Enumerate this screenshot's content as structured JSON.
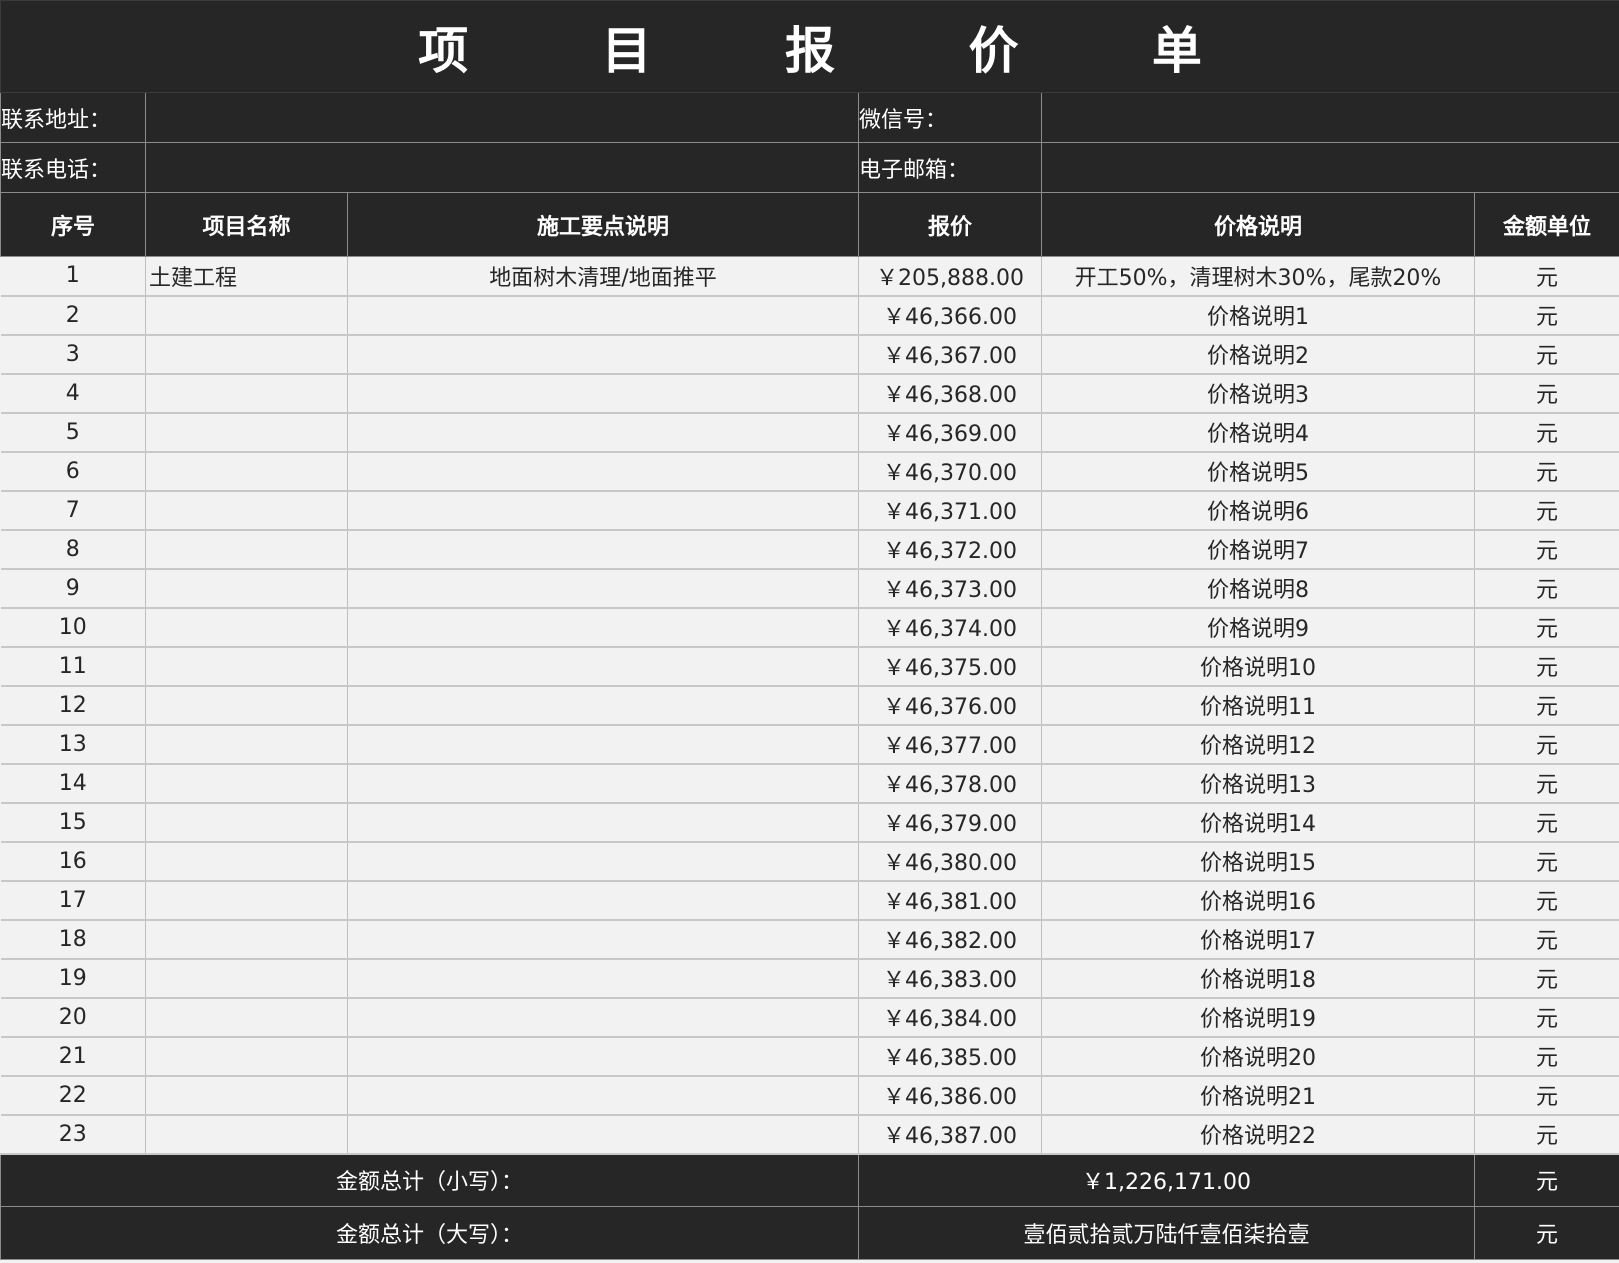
{
  "title": "项 目 报 价 单",
  "contact": {
    "address_label": "联系地址：",
    "address_value": "",
    "wechat_label": "微信号：",
    "wechat_value": "",
    "phone_label": "联系电话：",
    "phone_value": "",
    "email_label": "电子邮箱：",
    "email_value": ""
  },
  "columns": [
    "序号",
    "项目名称",
    "施工要点说明",
    "报价",
    "价格说明",
    "金额单位"
  ],
  "rows": [
    {
      "no": "1",
      "name": "土建工程",
      "points": "地面树木清理/地面推平",
      "price": "￥205,888.00",
      "note": "开工50%，清理树木30%，尾款20%",
      "unit": "元"
    },
    {
      "no": "2",
      "name": "",
      "points": "",
      "price": "￥46,366.00",
      "note": "价格说明1",
      "unit": "元"
    },
    {
      "no": "3",
      "name": "",
      "points": "",
      "price": "￥46,367.00",
      "note": "价格说明2",
      "unit": "元"
    },
    {
      "no": "4",
      "name": "",
      "points": "",
      "price": "￥46,368.00",
      "note": "价格说明3",
      "unit": "元"
    },
    {
      "no": "5",
      "name": "",
      "points": "",
      "price": "￥46,369.00",
      "note": "价格说明4",
      "unit": "元"
    },
    {
      "no": "6",
      "name": "",
      "points": "",
      "price": "￥46,370.00",
      "note": "价格说明5",
      "unit": "元"
    },
    {
      "no": "7",
      "name": "",
      "points": "",
      "price": "￥46,371.00",
      "note": "价格说明6",
      "unit": "元"
    },
    {
      "no": "8",
      "name": "",
      "points": "",
      "price": "￥46,372.00",
      "note": "价格说明7",
      "unit": "元"
    },
    {
      "no": "9",
      "name": "",
      "points": "",
      "price": "￥46,373.00",
      "note": "价格说明8",
      "unit": "元"
    },
    {
      "no": "10",
      "name": "",
      "points": "",
      "price": "￥46,374.00",
      "note": "价格说明9",
      "unit": "元"
    },
    {
      "no": "11",
      "name": "",
      "points": "",
      "price": "￥46,375.00",
      "note": "价格说明10",
      "unit": "元"
    },
    {
      "no": "12",
      "name": "",
      "points": "",
      "price": "￥46,376.00",
      "note": "价格说明11",
      "unit": "元"
    },
    {
      "no": "13",
      "name": "",
      "points": "",
      "price": "￥46,377.00",
      "note": "价格说明12",
      "unit": "元"
    },
    {
      "no": "14",
      "name": "",
      "points": "",
      "price": "￥46,378.00",
      "note": "价格说明13",
      "unit": "元"
    },
    {
      "no": "15",
      "name": "",
      "points": "",
      "price": "￥46,379.00",
      "note": "价格说明14",
      "unit": "元"
    },
    {
      "no": "16",
      "name": "",
      "points": "",
      "price": "￥46,380.00",
      "note": "价格说明15",
      "unit": "元"
    },
    {
      "no": "17",
      "name": "",
      "points": "",
      "price": "￥46,381.00",
      "note": "价格说明16",
      "unit": "元"
    },
    {
      "no": "18",
      "name": "",
      "points": "",
      "price": "￥46,382.00",
      "note": "价格说明17",
      "unit": "元"
    },
    {
      "no": "19",
      "name": "",
      "points": "",
      "price": "￥46,383.00",
      "note": "价格说明18",
      "unit": "元"
    },
    {
      "no": "20",
      "name": "",
      "points": "",
      "price": "￥46,384.00",
      "note": "价格说明19",
      "unit": "元"
    },
    {
      "no": "21",
      "name": "",
      "points": "",
      "price": "￥46,385.00",
      "note": "价格说明20",
      "unit": "元"
    },
    {
      "no": "22",
      "name": "",
      "points": "",
      "price": "￥46,386.00",
      "note": "价格说明21",
      "unit": "元"
    },
    {
      "no": "23",
      "name": "",
      "points": "",
      "price": "￥46,387.00",
      "note": "价格说明22",
      "unit": "元"
    }
  ],
  "totals": {
    "small_label": "金额总计（小写）：",
    "small_value": "￥1,226,171.00",
    "small_unit": "元",
    "big_label": "金额总计（大写）：",
    "big_value": "壹佰贰拾贰万陆仟壹佰柒拾壹",
    "big_unit": "元"
  },
  "colors": {
    "dark": "#262626",
    "light": "#f2f2f2"
  }
}
